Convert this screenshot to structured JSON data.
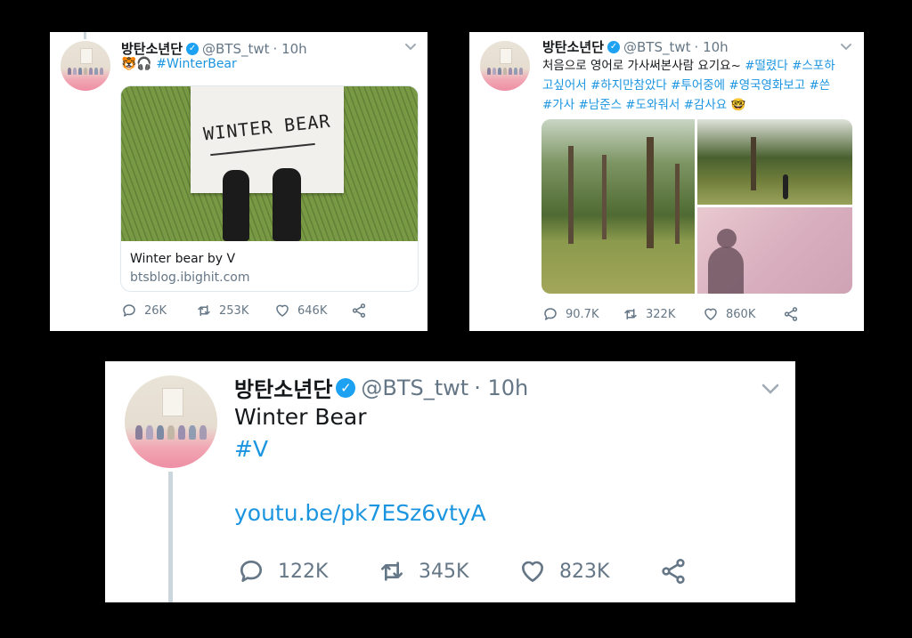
{
  "tweet1": {
    "name": "방탄소년단",
    "handle": "@BTS_twt",
    "time": "· 10h",
    "emoji": "🐯🎧",
    "hashtag": "#WinterBear",
    "card_image_text": "WINTER BEAR",
    "card_title": "Winter bear by V",
    "card_domain": "btsblog.ibighit.com",
    "replies": "26K",
    "retweets": "253K",
    "likes": "646K"
  },
  "tweet2": {
    "name": "방탄소년단",
    "handle": "@BTS_twt",
    "time": "· 10h",
    "line1_text": "처음으로 영어로 가사써본사람 요기요~",
    "line1_tags": "#떨렸다 #스포하",
    "line2_tags": "고싶어서 #하지만참았다 #투어중에 #영국영화보고 #쓴",
    "line3_tags": "#가사 #남준스 #도와줘서 #감사요",
    "line3_emoji": "🤓",
    "replies": "90.7K",
    "retweets": "322K",
    "likes": "860K"
  },
  "tweet3": {
    "name": "방탄소년단",
    "handle": "@BTS_twt",
    "time": "· 10h",
    "title": "Winter Bear",
    "hashtag": "#V",
    "link": "youtu.be/pk7ESz6vtyA",
    "replies": "122K",
    "retweets": "345K",
    "likes": "823K"
  },
  "colors": {
    "link_blue": "#1b95e0",
    "verified_blue": "#1da1f2",
    "muted_gray": "#657786",
    "background": "#000000"
  }
}
